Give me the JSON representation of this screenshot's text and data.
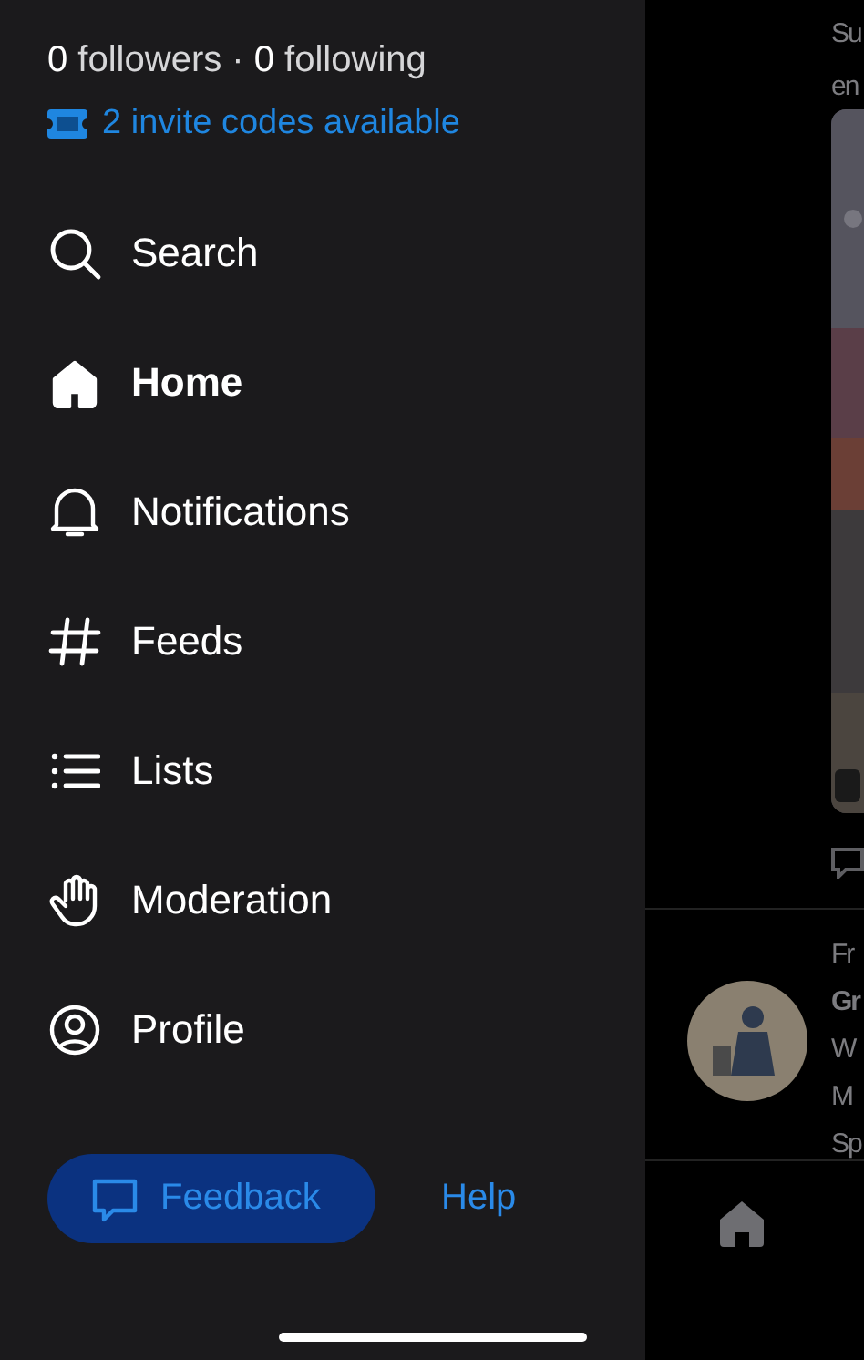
{
  "profile": {
    "stats": "**0** followers · **0** following",
    "invite": "2 invite codes available"
  },
  "menu": [
    {
      "label": "Search",
      "selected": false
    },
    {
      "label": "Home",
      "selected": true
    },
    {
      "label": "Notifications",
      "selected": false
    },
    {
      "label": "Feeds",
      "selected": false
    },
    {
      "label": "Lists",
      "selected": false
    },
    {
      "label": "Moderation",
      "selected": false
    },
    {
      "label": "Profile",
      "selected": false
    }
  ],
  "footer": {
    "feedback": "Feedback",
    "help": "Help"
  },
  "feed": {
    "post_1": {
      "text_lines": [
        "Su",
        "en"
      ]
    },
    "post_2": {
      "context": "Fr",
      "author": "Gr",
      "text_lines": [
        "W",
        "M",
        "Sp"
      ]
    }
  }
}
